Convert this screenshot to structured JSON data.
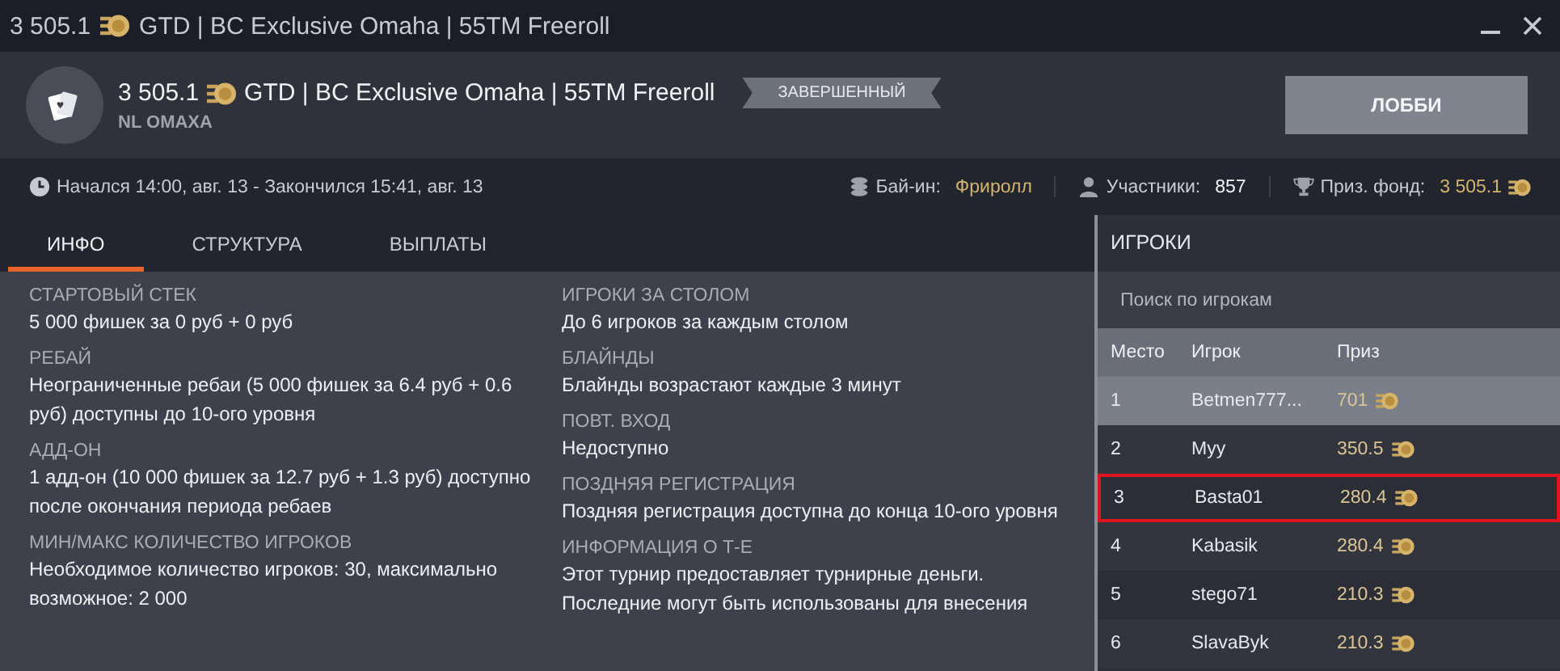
{
  "window": {
    "title_amount": "3 505.1",
    "title_rest": "GTD | BC Exclusive Omaha | 55TM Freeroll"
  },
  "header": {
    "amount": "3 505.1",
    "title": "GTD | BC Exclusive Omaha | 55TM Freeroll",
    "game": "NL OMAXA",
    "status_badge": "ЗАВЕРШЕННЫЙ",
    "lobby_button": "ЛОББИ"
  },
  "info_bar": {
    "time": "Начался 14:00, авг. 13  -  Закончился 15:41, авг. 13",
    "buyin_label": "Бай-ин:",
    "buyin_value": "Фриролл",
    "players_label": "Участники:",
    "players_value": "857",
    "prize_label": "Приз. фонд:",
    "prize_value": "3 505.1"
  },
  "tabs": [
    {
      "label": "ИНФО",
      "selected": true
    },
    {
      "label": "СТРУКТУРА",
      "selected": false
    },
    {
      "label": "ВЫПЛАТЫ",
      "selected": false
    }
  ],
  "info_columns": [
    [
      {
        "label": "СТАРТОВЫЙ СТЕК",
        "value": "5 000 фишек за 0 руб + 0 руб"
      },
      {
        "label": "РЕБАЙ",
        "value": "Неограниченные ребаи (5 000 фишек за 6.4 руб + 0.6 руб) доступны до 10-ого уровня"
      },
      {
        "label": "АДД-ОН",
        "value": "1 адд-он (10 000 фишек за 12.7 руб + 1.3 руб) доступно после окончания периода ребаев"
      },
      {
        "label": "МИН/МАКС КОЛИЧЕСТВО ИГРОКОВ",
        "value": "Необходимое количество игроков: 30, максимально возможное: 2 000"
      }
    ],
    [
      {
        "label": "ИГРОКИ ЗА СТОЛОМ",
        "value": "До 6 игроков за каждым столом"
      },
      {
        "label": "БЛАЙНДЫ",
        "value": "Блайнды возрастают каждые 3 минут"
      },
      {
        "label": "ПОВТ. ВХОД",
        "value": "Недоступно"
      },
      {
        "label": "ПОЗДНЯЯ РЕГИСТРАЦИЯ",
        "value": "Поздняя регистрация доступна до конца 10-ого уровня"
      },
      {
        "label": "ИНФОРМАЦИЯ О Т-Е",
        "value": "Этот турнир предоставляет турнирные деньги. Последние могут быть использованы для внесения"
      }
    ]
  ],
  "players": {
    "title": "ИГРОКИ",
    "search": {
      "placeholder": "Поиск по игрокам"
    },
    "columns": [
      "Место",
      "Игрок",
      "Приз"
    ],
    "rows": [
      {
        "place": "1",
        "player": "Betmen777...",
        "prize": "701",
        "selected": true,
        "highlighted": false
      },
      {
        "place": "2",
        "player": "Myy",
        "prize": "350.5",
        "selected": false,
        "highlighted": false
      },
      {
        "place": "3",
        "player": "Basta01",
        "prize": "280.4",
        "selected": false,
        "highlighted": true
      },
      {
        "place": "4",
        "player": "Kabasik",
        "prize": "280.4",
        "selected": false,
        "highlighted": false
      },
      {
        "place": "5",
        "player": "stego71",
        "prize": "210.3",
        "selected": false,
        "highlighted": false
      },
      {
        "place": "6",
        "player": "SlavaByk",
        "prize": "210.3",
        "selected": false,
        "highlighted": false
      }
    ]
  }
}
